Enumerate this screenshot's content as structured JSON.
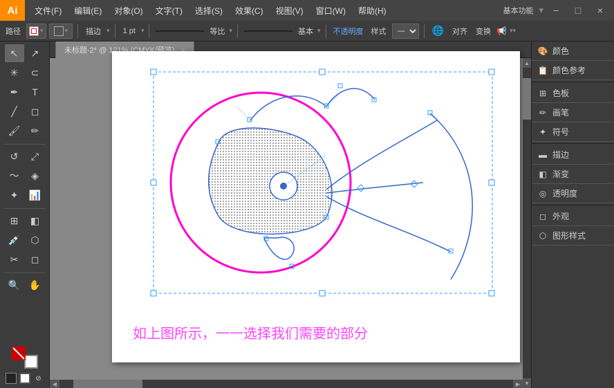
{
  "app": {
    "logo": "Ai",
    "profile_label": "基本功能",
    "title": "Adobe Illustrator"
  },
  "menu": {
    "items": [
      "文件(F)",
      "编辑(E)",
      "对象(O)",
      "文字(T)",
      "选择(S)",
      "效果(C)",
      "视图(V)",
      "窗口(W)",
      "帮助(H)"
    ]
  },
  "toolbar": {
    "path_label": "路径",
    "stroke_label": "描边",
    "stroke_width": "1 pt",
    "mode_label": "等比",
    "profile_label": "基本",
    "opacity_label": "不透明度",
    "style_label": "样式",
    "align_label": "对齐",
    "transform_label": "变换"
  },
  "canvas": {
    "tab_label": "未标题-2* @ 121% (CMYK/预览)",
    "tab_close": "×"
  },
  "right_panel": {
    "items": [
      {
        "icon": "🎨",
        "label": "颜色"
      },
      {
        "icon": "📋",
        "label": "颜色参考"
      },
      {
        "icon": "⊞",
        "label": "色板"
      },
      {
        "icon": "✏️",
        "label": "画笔"
      },
      {
        "icon": "✦",
        "label": "符号"
      },
      {
        "icon": "▬",
        "label": "描边"
      },
      {
        "icon": "◧",
        "label": "渐变"
      },
      {
        "icon": "◎",
        "label": "透明度"
      },
      {
        "icon": "◻",
        "label": "外观"
      },
      {
        "icon": "⬡",
        "label": "图形样式"
      }
    ]
  },
  "caption": {
    "text": "如上图所示，一一选择我们需要的部分"
  },
  "win_controls": {
    "minimize": "−",
    "maximize": "□",
    "close": "×"
  }
}
